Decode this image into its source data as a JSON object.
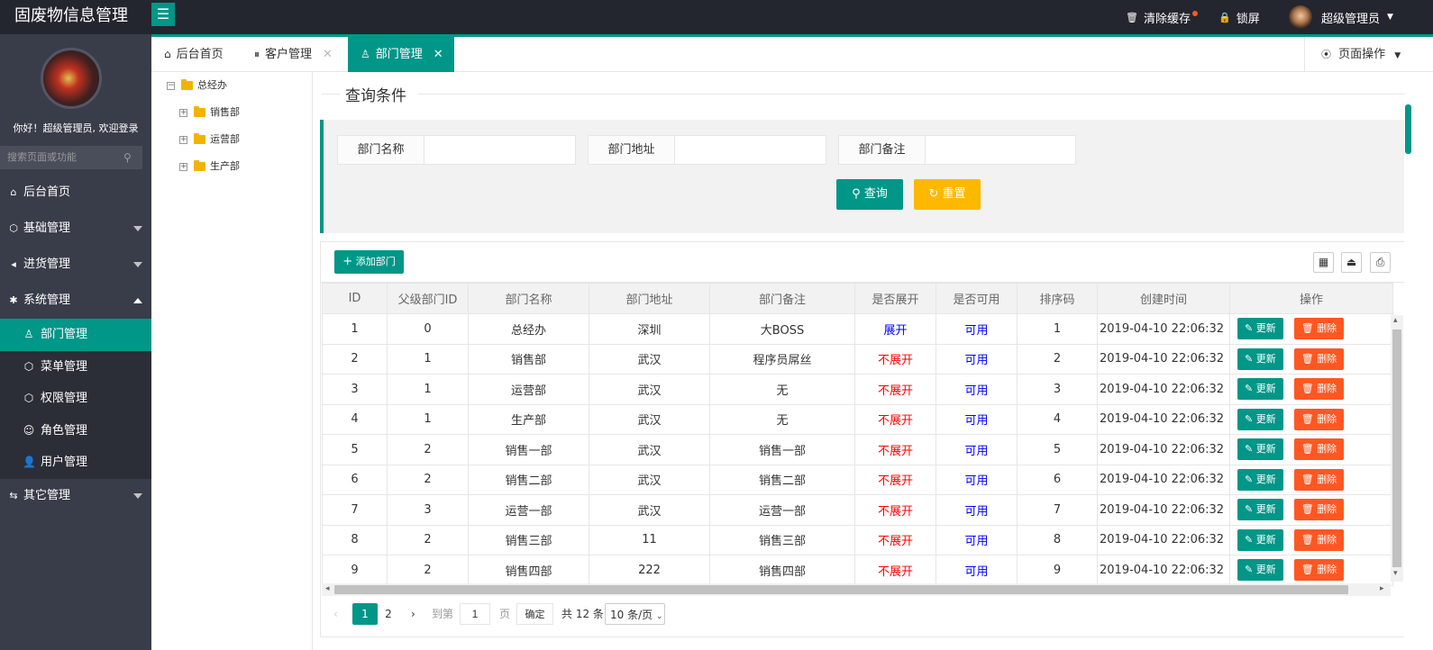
{
  "app": {
    "title": "固废物信息管理"
  },
  "topbar": {
    "clear_cache": "清除缓存",
    "lock_screen": "锁屏",
    "user_name": "超级管理员"
  },
  "sidebar": {
    "welcome": "你好！超级管理员, 欢迎登录",
    "search_placeholder": "搜索页面或功能",
    "nav": [
      {
        "label": "后台首页"
      },
      {
        "label": "基础管理"
      },
      {
        "label": "进货管理"
      },
      {
        "label": "系统管理"
      }
    ],
    "sub": [
      {
        "label": "部门管理"
      },
      {
        "label": "菜单管理"
      },
      {
        "label": "权限管理"
      },
      {
        "label": "角色管理"
      },
      {
        "label": "用户管理"
      }
    ],
    "other": {
      "label": "其它管理"
    }
  },
  "tabs": [
    {
      "label": "后台首页"
    },
    {
      "label": "客户管理"
    },
    {
      "label": "部门管理"
    }
  ],
  "page_ops": "页面操作",
  "tree": {
    "root": "总经办",
    "children": [
      "销售部",
      "运营部",
      "生产部"
    ]
  },
  "query": {
    "title": "查询条件",
    "fields": [
      {
        "label": "部门名称",
        "value": ""
      },
      {
        "label": "部门地址",
        "value": ""
      },
      {
        "label": "部门备注",
        "value": ""
      }
    ],
    "search_btn": "查询",
    "reset_btn": "重置"
  },
  "table": {
    "add_btn": "添加部门",
    "columns": [
      "ID",
      "父级部门ID",
      "部门名称",
      "部门地址",
      "部门备注",
      "是否展开",
      "是否可用",
      "排序码",
      "创建时间",
      "操作"
    ],
    "update_label": "更新",
    "delete_label": "删除",
    "rows": [
      [
        "1",
        "0",
        "总经办",
        "深圳",
        "大BOSS",
        "展开",
        "可用",
        "1",
        "2019-04-10 22:06:32"
      ],
      [
        "2",
        "1",
        "销售部",
        "武汉",
        "程序员屌丝",
        "不展开",
        "可用",
        "2",
        "2019-04-10 22:06:32"
      ],
      [
        "3",
        "1",
        "运营部",
        "武汉",
        "无",
        "不展开",
        "可用",
        "3",
        "2019-04-10 22:06:32"
      ],
      [
        "4",
        "1",
        "生产部",
        "武汉",
        "无",
        "不展开",
        "可用",
        "4",
        "2019-04-10 22:06:32"
      ],
      [
        "5",
        "2",
        "销售一部",
        "武汉",
        "销售一部",
        "不展开",
        "可用",
        "5",
        "2019-04-10 22:06:32"
      ],
      [
        "6",
        "2",
        "销售二部",
        "武汉",
        "销售二部",
        "不展开",
        "可用",
        "6",
        "2019-04-10 22:06:32"
      ],
      [
        "7",
        "3",
        "运营一部",
        "武汉",
        "运营一部",
        "不展开",
        "可用",
        "7",
        "2019-04-10 22:06:32"
      ],
      [
        "8",
        "2",
        "销售三部",
        "11",
        "销售三部",
        "不展开",
        "可用",
        "8",
        "2019-04-10 22:06:32"
      ],
      [
        "9",
        "2",
        "销售四部",
        "222",
        "销售四部",
        "不展开",
        "可用",
        "9",
        "2019-04-10 22:06:32"
      ]
    ]
  },
  "pager": {
    "current": "1",
    "next_page": "2",
    "goto_label": "到第",
    "goto_value": "1",
    "page_unit": "页",
    "confirm": "确定",
    "total": "共 12 条",
    "per_page": "10 条/页"
  },
  "colors": {
    "accent": "#009688",
    "sidebar": "#393d49",
    "topbar": "#23262e",
    "warn": "#ffb800",
    "danger": "#ff5722"
  }
}
